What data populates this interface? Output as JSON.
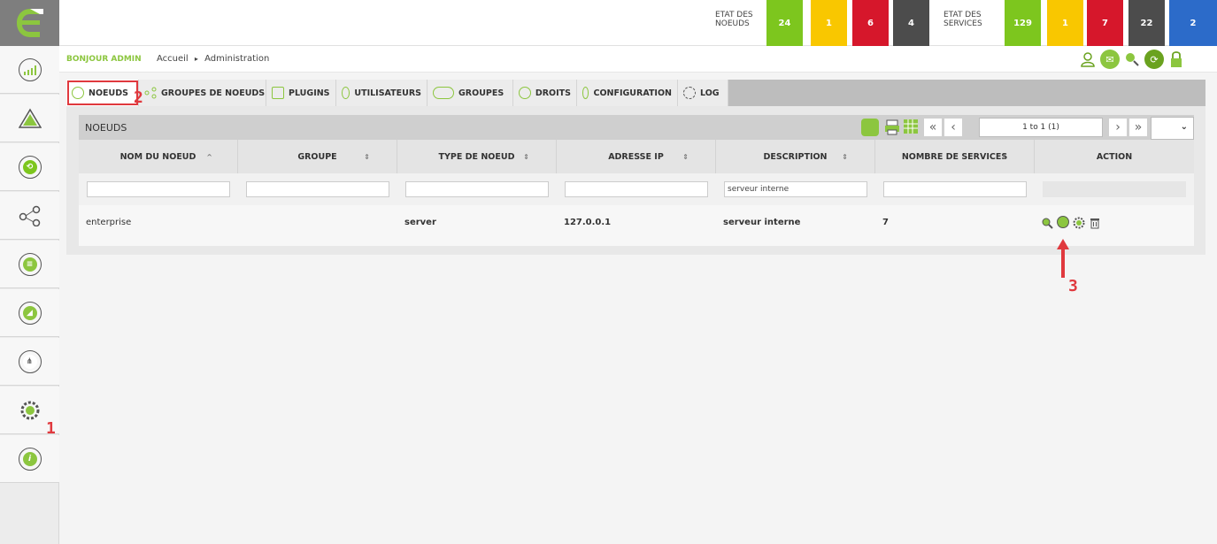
{
  "colors": {
    "brand_green": "#8cc63f",
    "status_green": "#7dc61e",
    "status_yellow": "#f9c700",
    "status_red": "#d6172b",
    "status_dark": "#4c4c4c",
    "status_blue": "#2c6bc9",
    "annotation_red": "#e0393e"
  },
  "header": {
    "nodes_status_label": "ETAT DES NOEUDS",
    "nodes_status_label_line1": "ETAT DES",
    "nodes_status_label_line2": "NOEUDS",
    "nodes_counts": [
      "24",
      "1",
      "6",
      "4"
    ],
    "services_status_label_line1": "ETAT DES",
    "services_status_label_line2": "SERVICES",
    "services_counts": [
      "129",
      "1",
      "7",
      "22",
      "2"
    ]
  },
  "breadcrumb": {
    "greeting": "BONJOUR ADMIN",
    "home": "Accueil",
    "separator": "▸",
    "current": "Administration"
  },
  "sidebar_items": [
    "dashboard-icon",
    "alert-icon",
    "history-icon",
    "network-icon",
    "report-icon",
    "satellite-icon",
    "topology-icon",
    "settings-icon",
    "info-icon"
  ],
  "tabs": [
    {
      "label": "NOEUDS",
      "icon": "node-icon"
    },
    {
      "label": "GROUPES DE NOEUDS",
      "icon": "node-group-icon"
    },
    {
      "label": "PLUGINS",
      "icon": "plugin-icon"
    },
    {
      "label": "UTILISATEURS",
      "icon": "user-icon"
    },
    {
      "label": "GROUPES",
      "icon": "group-icon"
    },
    {
      "label": "DROITS",
      "icon": "rights-icon"
    },
    {
      "label": "CONFIGURATION",
      "icon": "location-icon"
    },
    {
      "label": "LOG",
      "icon": "log-icon"
    }
  ],
  "table": {
    "title": "NOEUDS",
    "pager": "1 to 1 (1)",
    "columns": [
      "NOM DU NOEUD",
      "GROUPE",
      "TYPE DE NOEUD",
      "ADRESSE IP",
      "DESCRIPTION",
      "NOMBRE DE SERVICES",
      "ACTION"
    ],
    "filters": [
      "",
      "",
      "",
      "",
      "serveur interne",
      "",
      ""
    ],
    "rows": [
      {
        "name": "enterprise",
        "group": "",
        "type": "server",
        "ip": "127.0.0.1",
        "description": "serveur interne",
        "services": "7"
      }
    ]
  },
  "annotations": [
    "1",
    "2",
    "3"
  ]
}
